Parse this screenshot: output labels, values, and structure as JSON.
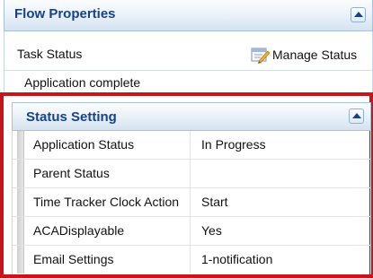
{
  "flow_properties": {
    "title": "Flow Properties",
    "collapse_icon": "chevron-up-icon"
  },
  "task_status": {
    "label": "Task Status",
    "manage_label": "Manage Status",
    "manage_icon": "edit-pencil-icon",
    "value": "Application complete"
  },
  "status_setting": {
    "title": "Status Setting",
    "highlight_color": "#c8141b",
    "rows": [
      {
        "label": "Application Status",
        "value": "In Progress"
      },
      {
        "label": "Parent Status",
        "value": ""
      },
      {
        "label": "Time Tracker Clock Action",
        "value": "Start"
      },
      {
        "label": "ACADisplayable",
        "value": "Yes"
      },
      {
        "label": "Email Settings",
        "value": "1-notification"
      }
    ]
  },
  "colors": {
    "header_text": "#15428b",
    "header_border": "#a9c1da"
  }
}
